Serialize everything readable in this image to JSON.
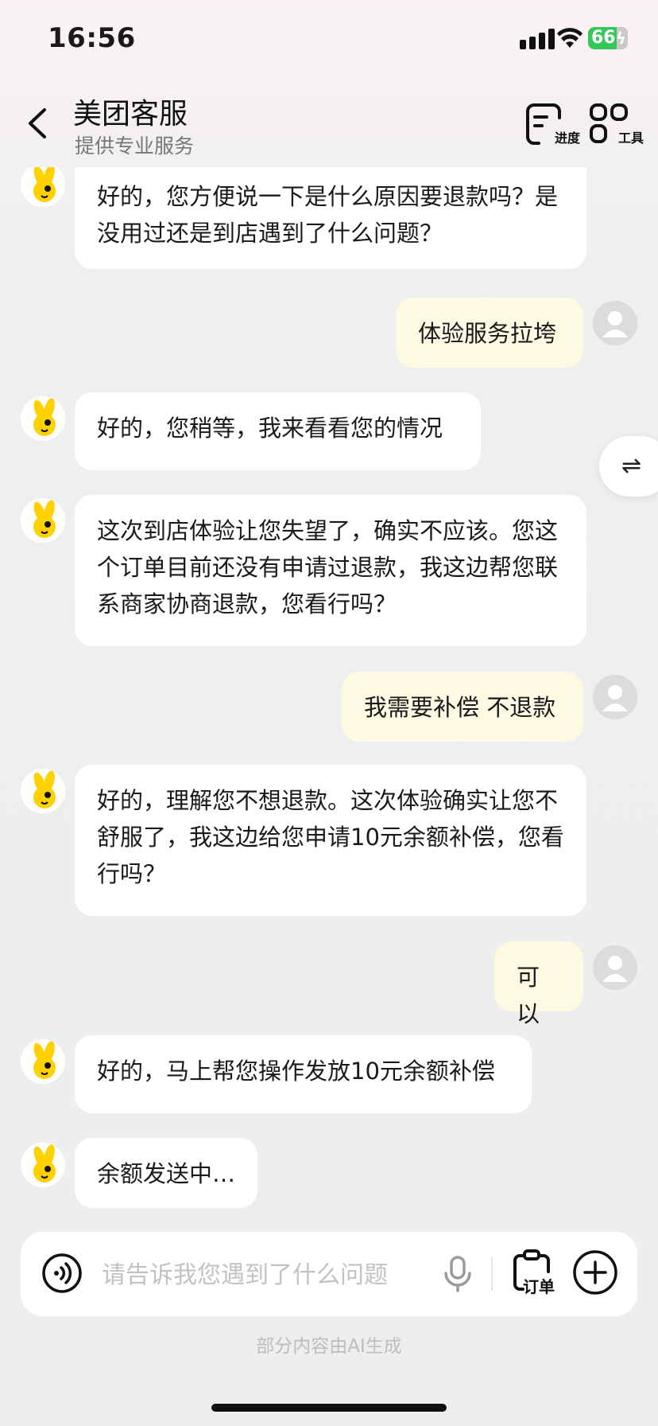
{
  "status_bar": {
    "time": "16:56",
    "battery": "66"
  },
  "header": {
    "title": "美团客服",
    "subtitle": "提供专业服务",
    "progress_label": "进度",
    "tools_label": "工具"
  },
  "messages": [
    {
      "from": "bot",
      "text": "好的，您方便说一下是什么原因要退款吗？是没用过还是到店遇到了什么问题？"
    },
    {
      "from": "user",
      "text": "体验服务拉垮"
    },
    {
      "from": "bot",
      "text": "好的，您稍等，我来看看您的情况"
    },
    {
      "from": "bot",
      "text": "这次到店体验让您失望了，确实不应该。您这个订单目前还没有申请过退款，我这边帮您联系商家协商退款，您看行吗？"
    },
    {
      "from": "user",
      "text": "我需要补偿 不退款"
    },
    {
      "from": "bot",
      "text": "好的，理解您不想退款。这次体验确实让您不舒服了，我这边给您申请10元余额补偿，您看行吗？"
    },
    {
      "from": "user",
      "text": "可以"
    },
    {
      "from": "bot",
      "text": "好的，马上帮您操作发放10元余额补偿"
    },
    {
      "from": "bot",
      "text": "余额发送中…"
    }
  ],
  "side_toggle": {
    "icon": "⇌"
  },
  "input": {
    "placeholder": "请告诉我您遇到了什么问题",
    "order_label": "订单"
  },
  "footer": {
    "ai_note": "部分内容由AI生成"
  },
  "colors": {
    "user_bubble": "#fdf9e3",
    "bot_bubble": "#ffffff",
    "mascot": "#ffd100"
  }
}
